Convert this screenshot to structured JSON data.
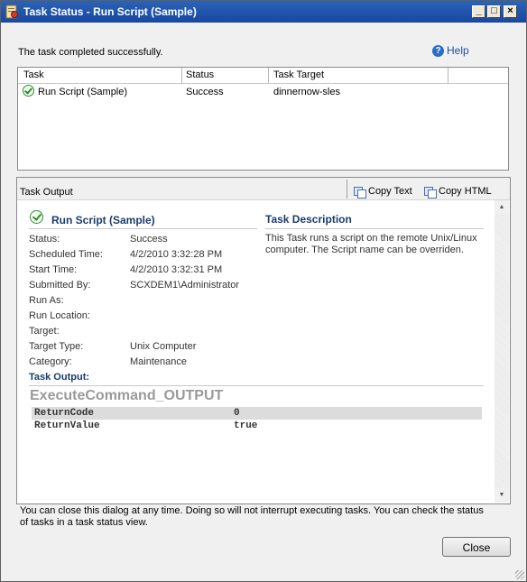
{
  "window": {
    "title": "Task Status - Run Script (Sample)",
    "minimize": "_",
    "maximize": "□",
    "close": "×"
  },
  "status_message": "The task completed successfully.",
  "help_label": "Help",
  "task_table": {
    "columns": [
      "Task",
      "Status",
      "Task Target"
    ],
    "rows": [
      {
        "task": "Run Script (Sample)",
        "status": "Success",
        "target": "dinnernow-sles"
      }
    ]
  },
  "output": {
    "title": "Task Output",
    "copy_text": "Copy Text",
    "copy_html": "Copy HTML",
    "task_name": "Run Script (Sample)",
    "description_heading": "Task Description",
    "description": "This Task runs a script on the remote Unix/Linux computer. The Script name can be overriden.",
    "properties": [
      {
        "label": "Status:",
        "value": "Success"
      },
      {
        "label": "Scheduled Time:",
        "value": "4/2/2010 3:32:28 PM"
      },
      {
        "label": "Start Time:",
        "value": "4/2/2010 3:32:31 PM"
      },
      {
        "label": "Submitted By:",
        "value": "SCXDEM1\\Administrator"
      },
      {
        "label": "Run As:",
        "value": ""
      },
      {
        "label": "Run Location:",
        "value": ""
      },
      {
        "label": "Target:",
        "value": ""
      },
      {
        "label": "Target Type:",
        "value": "Unix Computer"
      },
      {
        "label": "Category:",
        "value": "Maintenance"
      }
    ],
    "task_output_label": "Task Output:",
    "command_title": "ExecuteCommand_OUTPUT",
    "results": [
      {
        "name": "ReturnCode",
        "value": "0"
      },
      {
        "name": "ReturnValue",
        "value": "true"
      }
    ]
  },
  "footer_text": "You can close this dialog at any time.  Doing so will not interrupt executing tasks.  You can check the status of tasks in a task status view.",
  "close_button": "Close",
  "colors": {
    "titlebar": "#1947a0",
    "heading": "#1a3c6e",
    "help_link": "#1c4ea4",
    "success_green": "#2f8a2f"
  }
}
